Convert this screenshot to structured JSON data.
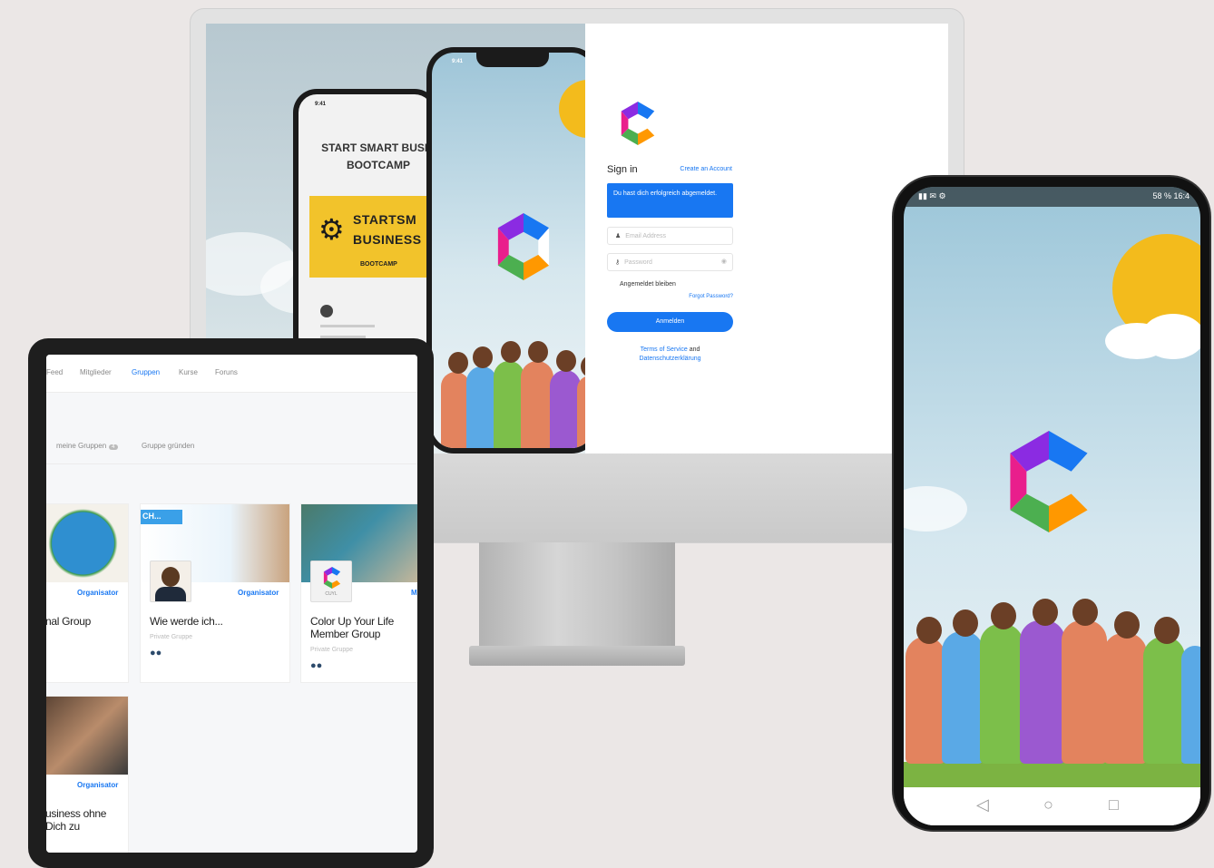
{
  "desktop": {
    "promo_phone": {
      "time": "9:41",
      "title_line1": "START SMART BUSIN",
      "title_line2": "BOOTCAMP",
      "banner_line1": "STARTSM",
      "banner_line2": "BUSINESS",
      "banner_sub": "BOOTCAMP"
    },
    "front_phone": {
      "time": "9:41"
    },
    "signin": {
      "title": "Sign in",
      "create_account": "Create an Account",
      "banner": "Du hast dich erfolgreich abgemeldet.",
      "email_placeholder": "Email Address",
      "password_placeholder": "Password",
      "remember": "Angemeldet bleiben",
      "forgot": "Forgot Password?",
      "login_button": "Anmelden",
      "terms_link": "Terms of Service",
      "terms_and": "and",
      "privacy_link": "Datenschutzerklärung"
    }
  },
  "tablet": {
    "tabs": [
      {
        "label": "Feed"
      },
      {
        "label": "Mitglieder"
      },
      {
        "label": "Gruppen",
        "active": true
      },
      {
        "label": "Kurse"
      },
      {
        "label": "Foruns"
      }
    ],
    "filters": {
      "my_groups": "meine Gruppen",
      "my_groups_count": "4",
      "create_group": "Gruppe gründen"
    },
    "cards": [
      {
        "organizer": "Organisator",
        "title": "nal Group"
      },
      {
        "banner_text": "CH...",
        "organizer": "Organisator",
        "title": "Wie werde ich...",
        "subtitle": "Private Gruppe"
      },
      {
        "organizer": "M",
        "thumb_label": "CUYL",
        "title": "Color Up Your Life Member Group",
        "subtitle": "Private Gruppe"
      },
      {
        "organizer": "Organisator",
        "title": "usiness ohne Dich zu"
      }
    ]
  },
  "phone": {
    "status_right": "58 %  16:4",
    "nav": {
      "back": "◁",
      "home": "○",
      "recent": "□"
    }
  },
  "colors": {
    "accent": "#1877f2",
    "sun": "#f3bb1c",
    "background": "#ebe7e6"
  }
}
